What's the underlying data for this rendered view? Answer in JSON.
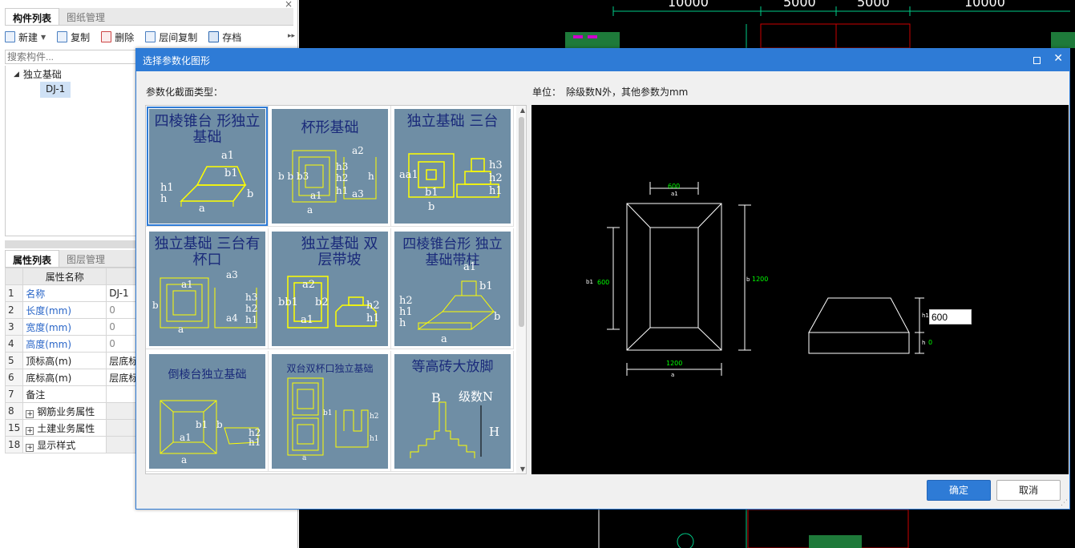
{
  "left_panel": {
    "close_glyph": "×",
    "top_tabs": [
      "构件列表",
      "图纸管理"
    ],
    "toolbar": {
      "new_label": "新建",
      "copy_label": "复制",
      "delete_label": "删除",
      "floor_copy_label": "层间复制",
      "save_label": "存档"
    },
    "search_placeholder": "搜索构件...",
    "tree": {
      "root_label": "独立基础",
      "child_label": "DJ-1"
    },
    "prop_tabs": [
      "属性列表",
      "图层管理"
    ],
    "prop_header": "属性名称",
    "properties": [
      {
        "num": "1",
        "name": "名称",
        "value": "DJ-1"
      },
      {
        "num": "2",
        "name": "长度(mm)",
        "value": "0"
      },
      {
        "num": "3",
        "name": "宽度(mm)",
        "value": "0"
      },
      {
        "num": "4",
        "name": "高度(mm)",
        "value": "0"
      },
      {
        "num": "5",
        "name": "顶标高(m)",
        "value": "层底标"
      },
      {
        "num": "6",
        "name": "底标高(m)",
        "value": "层底标"
      },
      {
        "num": "7",
        "name": "备注",
        "value": ""
      },
      {
        "num": "8",
        "name": "钢筋业务属性",
        "value": ""
      },
      {
        "num": "15",
        "name": "土建业务属性",
        "value": ""
      },
      {
        "num": "18",
        "name": "显示样式",
        "value": ""
      }
    ]
  },
  "cad": {
    "dims": [
      "10000",
      "5000",
      "5000",
      "10000"
    ]
  },
  "dialog": {
    "title": "选择参数化图形",
    "type_label": "参数化截面类型：",
    "unit_label": "单位：",
    "unit_text": "除级数N外，其他参数为mm",
    "thumbnails": [
      {
        "title": "四棱锥台 形独立基础"
      },
      {
        "title": "杯形基础"
      },
      {
        "title": "独立基础 三台"
      },
      {
        "title": "独立基础 三台有杯口"
      },
      {
        "title": "独立基础 双层带坡"
      },
      {
        "title": "四棱锥台形 独立基础带柱"
      },
      {
        "title": "倒棱台独立基础"
      },
      {
        "title": "双台双杯口独立基础"
      },
      {
        "title": "等高砖大放脚"
      }
    ],
    "preview": {
      "a1_value": "600",
      "a1_label": "a1",
      "b1_label": "b1",
      "b1_value": "600",
      "b_label": "b",
      "b_value": "1200",
      "a_value": "1200",
      "a_label": "a",
      "h1_label": "h1",
      "h1_value": "600",
      "h_label": "h",
      "h_value": "0"
    },
    "ok_label": "确定",
    "cancel_label": "取消"
  }
}
